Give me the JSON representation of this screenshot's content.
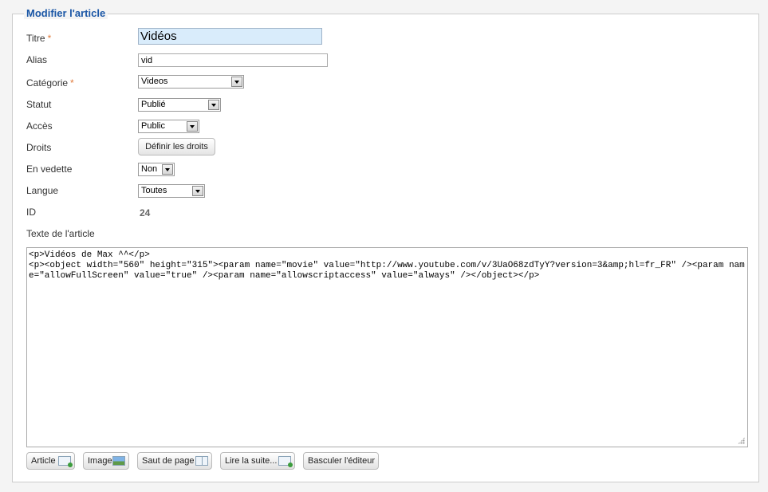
{
  "form": {
    "legend": "Modifier l'article",
    "required_mark": "*"
  },
  "fields": {
    "title": {
      "label": "Titre",
      "value": "Vidéos"
    },
    "alias": {
      "label": "Alias",
      "value": "vid"
    },
    "category": {
      "label": "Catégorie",
      "value": "Videos"
    },
    "status": {
      "label": "Statut",
      "value": "Publié"
    },
    "access": {
      "label": "Accès",
      "value": "Public"
    },
    "rights": {
      "label": "Droits",
      "button": "Définir les droits"
    },
    "featured": {
      "label": "En vedette",
      "value": "Non"
    },
    "language": {
      "label": "Langue",
      "value": "Toutes"
    },
    "id": {
      "label": "ID",
      "value": "24"
    },
    "text": {
      "label": "Texte de l'article",
      "content": "<p>Vidéos de Max ^^</p>\n<p><object width=\"560\" height=\"315\"><param name=\"movie\" value=\"http://www.youtube.com/v/3UaO68zdTyY?version=3&amp;hl=fr_FR\" /><param name=\"allowFullScreen\" value=\"true\" /><param name=\"allowscriptaccess\" value=\"always\" /></object></p>"
    }
  },
  "editor_buttons": {
    "article": "Article",
    "image": "Image",
    "pagebreak": "Saut de page",
    "readmore": "Lire la suite...",
    "toggle": "Basculer l'éditeur"
  },
  "icons": {
    "article": "article-add-icon",
    "image": "image-icon",
    "pagebreak": "pagebreak-icon",
    "readmore": "readmore-icon"
  },
  "colors": {
    "legend": "#1b57a6",
    "required": "#e0793a",
    "title_bg": "#d9ecfb"
  }
}
